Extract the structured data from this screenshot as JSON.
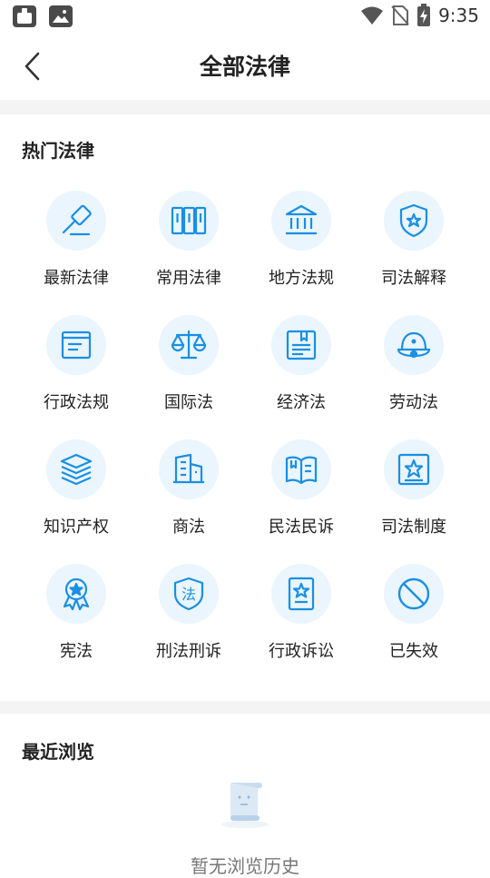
{
  "status": {
    "time": "9:35"
  },
  "header": {
    "title": "全部法律"
  },
  "hot": {
    "title": "热门法律",
    "items": [
      {
        "label": "最新法律",
        "icon": "gavel-icon"
      },
      {
        "label": "常用法律",
        "icon": "books-icon"
      },
      {
        "label": "地方法规",
        "icon": "courthouse-icon"
      },
      {
        "label": "司法解释",
        "icon": "shield-star-icon"
      },
      {
        "label": "行政法规",
        "icon": "document-icon"
      },
      {
        "label": "国际法",
        "icon": "scales-icon"
      },
      {
        "label": "经济法",
        "icon": "bookmarked-book-icon"
      },
      {
        "label": "劳动法",
        "icon": "helmet-icon"
      },
      {
        "label": "知识产权",
        "icon": "layers-icon"
      },
      {
        "label": "商法",
        "icon": "building-icon"
      },
      {
        "label": "民法民诉",
        "icon": "open-book-icon"
      },
      {
        "label": "司法制度",
        "icon": "star-frame-icon"
      },
      {
        "label": "宪法",
        "icon": "medal-icon"
      },
      {
        "label": "刑法刑诉",
        "icon": "law-shield-icon",
        "glyph": "法"
      },
      {
        "label": "行政诉讼",
        "icon": "certificate-icon"
      },
      {
        "label": "已失效",
        "icon": "prohibited-icon"
      }
    ]
  },
  "recent": {
    "title": "最近浏览",
    "empty_text": "暂无浏览历史"
  },
  "colors": {
    "accent": "#1a8fe3",
    "icon_bg": "#eaf5fd",
    "divider": "#f4f4f4"
  }
}
